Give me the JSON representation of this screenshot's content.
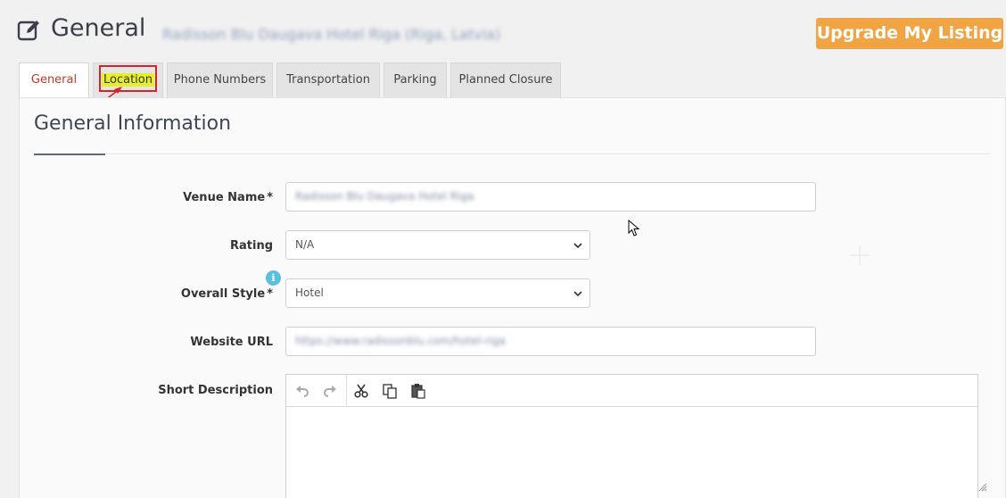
{
  "header": {
    "title": "General",
    "venue_subtitle": "Radisson Blu Daugava Hotel Riga (Riga, Latvia)",
    "upgrade_label": "Upgrade My Listing"
  },
  "tabs": [
    {
      "label": "General",
      "active": true
    },
    {
      "label": "Location",
      "active": false,
      "highlighted": true
    },
    {
      "label": "Phone Numbers",
      "active": false
    },
    {
      "label": "Transportation",
      "active": false
    },
    {
      "label": "Parking",
      "active": false
    },
    {
      "label": "Planned Closure",
      "active": false
    }
  ],
  "section": {
    "title": "General Information"
  },
  "form": {
    "venue_name": {
      "label": "Venue Name",
      "required": "*",
      "value": "Radisson Blu Daugava Hotel Riga"
    },
    "rating": {
      "label": "Rating",
      "value": "N/A"
    },
    "overall_style": {
      "label": "Overall Style",
      "required": "*",
      "value": "Hotel",
      "info_icon": "i"
    },
    "website_url": {
      "label": "Website URL",
      "value": "https://www.radissonblu.com/hotel-riga"
    },
    "short_description": {
      "label": "Short Description",
      "value": ""
    }
  },
  "colors": {
    "accent_orange": "#f0a444",
    "active_tab_text": "#c0392b",
    "highlight_yellow": "#e7ef28",
    "annotation_red": "#d0262a",
    "info_blue": "#5bc0de"
  },
  "icons": [
    "edit-icon",
    "undo-icon",
    "redo-icon",
    "cut-icon",
    "copy-icon",
    "paste-icon",
    "chevron-down-icon",
    "info-icon",
    "mouse-cursor-icon",
    "resize-grip-icon"
  ]
}
